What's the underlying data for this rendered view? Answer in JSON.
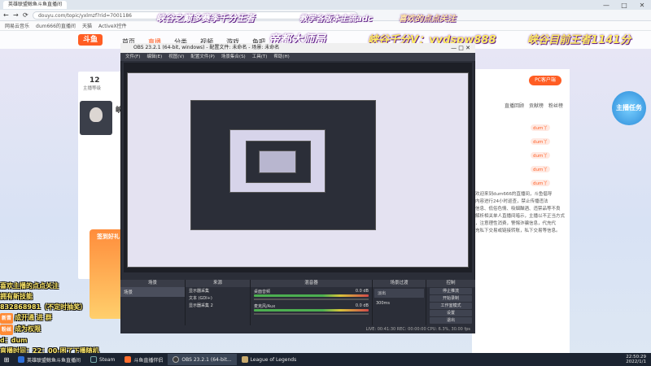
{
  "browser": {
    "tab_title": "英雄联盟鲸鱼斗鱼直播间",
    "url_text": "douyu.com/topic/yxlmzf?rid=7001186",
    "bookmarks": [
      "网易云音乐",
      "dum666的直播间",
      "天猫",
      "ActiveX控件"
    ],
    "window_controls": [
      "—",
      "□",
      "✕"
    ]
  },
  "overlay": {
    "banner_left": "峡谷之巅多赛季千分王者",
    "banner_mid": "教学各版本主流adc",
    "banner_right": "喜欢的点点关注",
    "subtitle_center": "帝都大师局",
    "subtitle_price": "峡谷千分V：yydspw888",
    "subtitle_right": "峡谷目前王者1141分",
    "left_lines": [
      {
        "badge": "",
        "text": "喜欢主播的点点关注"
      },
      {
        "badge": "",
        "text": "拥有新技能"
      },
      {
        "badge": "",
        "text": "832868981（不定时抽奖）"
      },
      {
        "badge": "新晋",
        "text": "成开通     进    群"
      },
      {
        "badge": "粉丝",
        "text": "成为权限"
      },
      {
        "badge": "",
        "text": "d：dum"
      },
      {
        "badge": "",
        "text": "直播时间：22：00-困了下播随机"
      }
    ]
  },
  "site": {
    "logo": "斗鱼",
    "nav": [
      "首页",
      "直播",
      "分类",
      "视频",
      "游戏",
      "鱼吧"
    ],
    "nav_active": 1,
    "follow_label": "主播等级",
    "follow_count": "12",
    "fans_label": "粉丝",
    "anchor_name": "峡",
    "status_cards": [
      "签到好礼"
    ],
    "right_header_badge": "PC客户端",
    "right_tabs": [
      "直播回顾",
      "贡献榜",
      "粉丝榜"
    ],
    "right_pills": [
      "dum丫",
      "dum丫",
      "dum丫",
      "dum丫",
      "dum丫"
    ],
    "right_chat": [
      "欢迎来到dum666的直播间，斗鱼倡导",
      "内容进行24小时巡查，禁止传播违法",
      "信息、低俗色情、吸烟酗酒、违禁品等不良",
      "解析相关单人直播间暗示，主播以不正当方式",
      "，注意理性消费，警惕诈骗信息，代充代",
      "充私下交易或链接转账，私下交易等信息。"
    ],
    "mission_label": "主播任务"
  },
  "obs": {
    "title": "OBS 23.2.1 (64-bit, windows) - 配置文件: 未命名 - 场景: 未命名",
    "menu": [
      "文件(F)",
      "编辑(E)",
      "视图(V)",
      "配置文件(P)",
      "场景集合(S)",
      "工具(T)",
      "帮助(H)"
    ],
    "docks": [
      "场景",
      "来源",
      "混音器",
      "场景过渡",
      "控制"
    ],
    "scene_item": "场景",
    "sources": [
      "显示器采集",
      "文本 (GDI+)",
      "显示器采集 2"
    ],
    "mixer_tracks": [
      {
        "name": "桌面音频",
        "db": "0.0 dB"
      },
      {
        "name": "麦克风/Aux",
        "db": "0.0 dB"
      }
    ],
    "transition_label": "淡出",
    "transition_duration": "300ms",
    "controls": [
      "停止推流",
      "开始录制",
      "工作室模式",
      "设置",
      "退出"
    ],
    "status": "LIVE: 00:41:30   REC: 00:00:00   CPU: 6.3%, 30.00 fps"
  },
  "taskbar": {
    "items": [
      {
        "label": "英雄联盟鲸鱼斗鱼直播间",
        "active": false,
        "color": "#2e6fd9"
      },
      {
        "label": "Steam",
        "active": false,
        "color": "#1b2838"
      },
      {
        "label": "斗鱼直播伴侣",
        "active": false,
        "color": "#ff6d2d"
      },
      {
        "label": "OBS 23.2.1 (64-bit...",
        "active": true,
        "color": "#3c3c3c"
      },
      {
        "label": "League of Legends",
        "active": false,
        "color": "#c8aa6e"
      }
    ],
    "clock_time": "22:50:29",
    "clock_date": "2022/1/1"
  }
}
